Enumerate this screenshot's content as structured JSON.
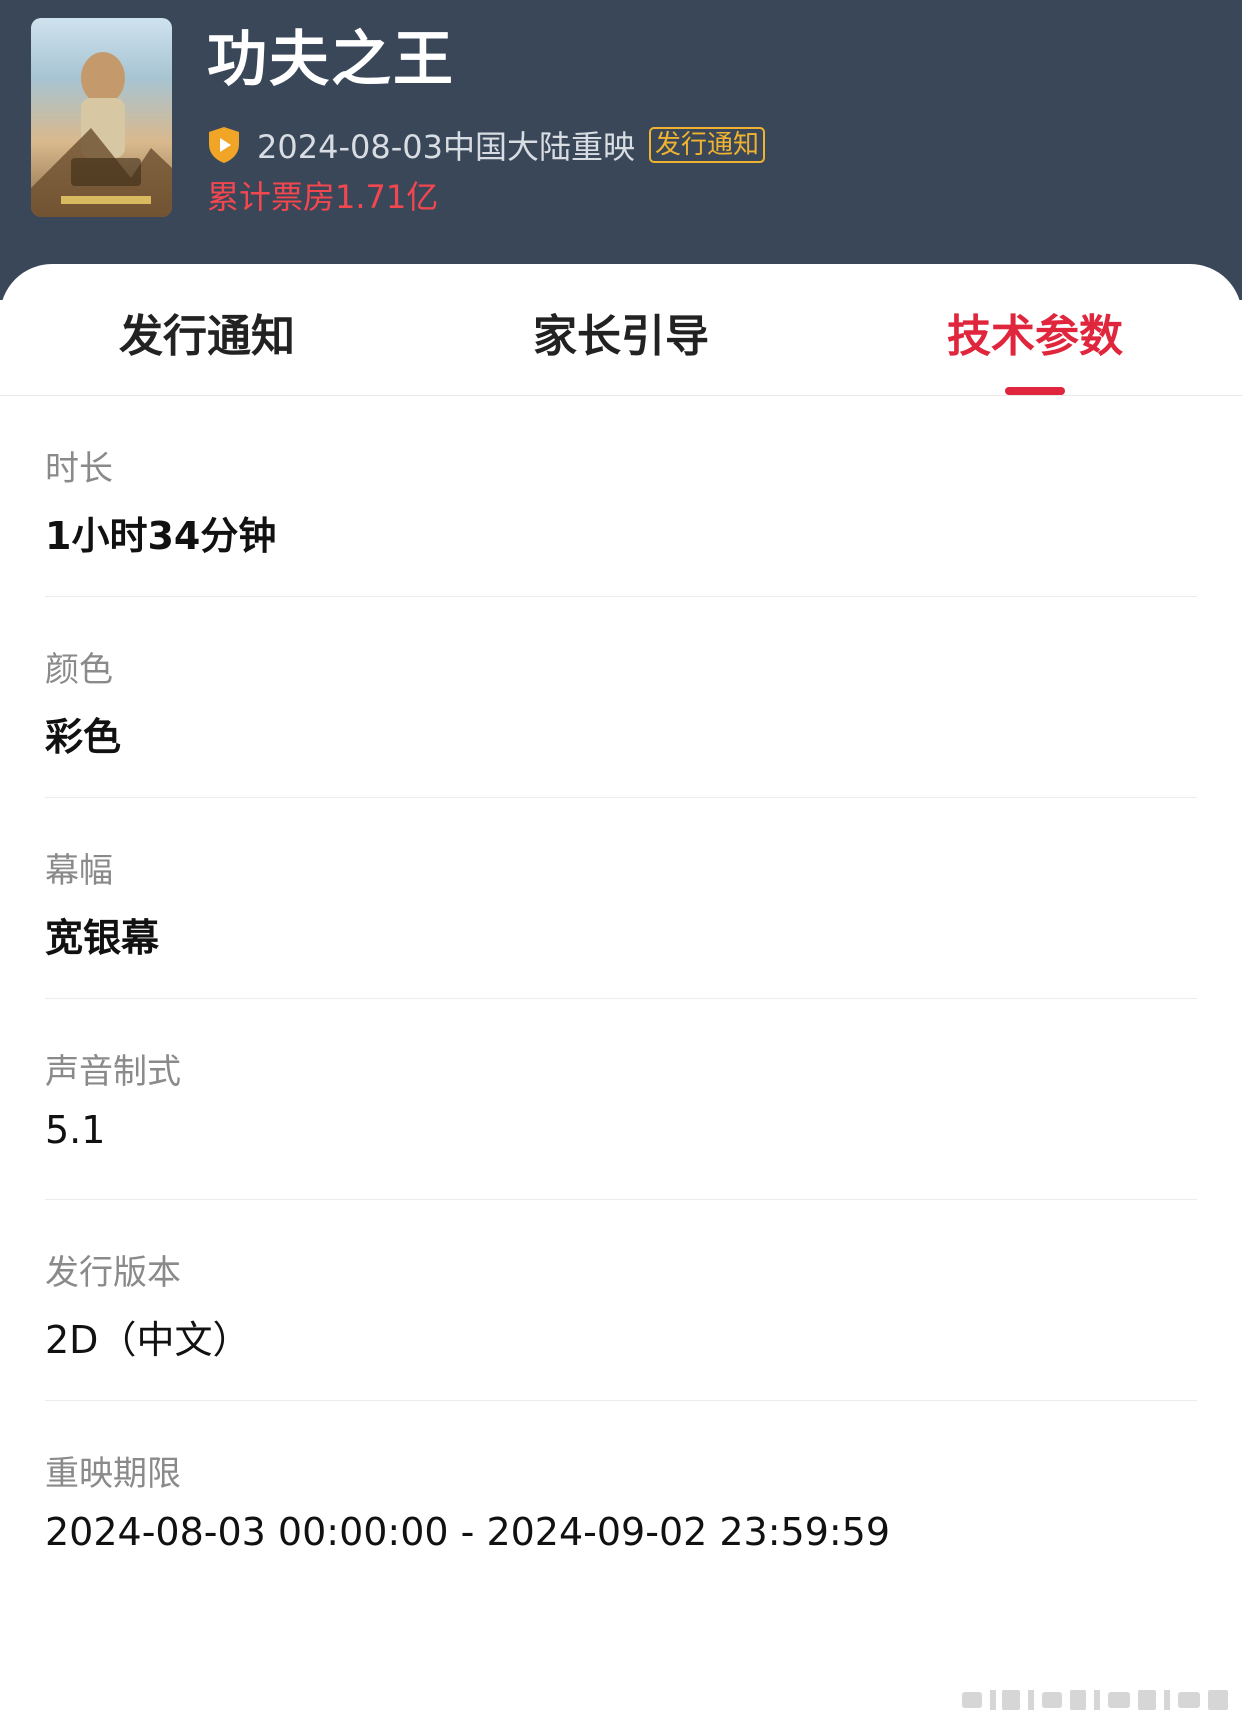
{
  "movie": {
    "title": "功夫之王",
    "release_info": "2024-08-03中国大陆重映",
    "notice_tag": "发行通知",
    "box_office": "累计票房1.71亿"
  },
  "tabs": [
    {
      "label": "发行通知"
    },
    {
      "label": "家长引导"
    },
    {
      "label": "技术参数"
    }
  ],
  "active_tab": "技术参数",
  "params": [
    {
      "label": "时长",
      "value": "1小时34分钟"
    },
    {
      "label": "颜色",
      "value": "彩色"
    },
    {
      "label": "幕幅",
      "value": "宽银幕"
    },
    {
      "label": "声音制式",
      "value": "5.1"
    },
    {
      "label": "发行版本",
      "value": "2D（中文）"
    },
    {
      "label": "重映期限",
      "value": "2024-08-03 00:00:00 - 2024-09-02 23:59:59"
    }
  ],
  "colors": {
    "header_bg": "#3a4759",
    "accent_red": "#e0263c",
    "box_office_red": "#f2474f",
    "tag_gold": "#f0b331"
  }
}
